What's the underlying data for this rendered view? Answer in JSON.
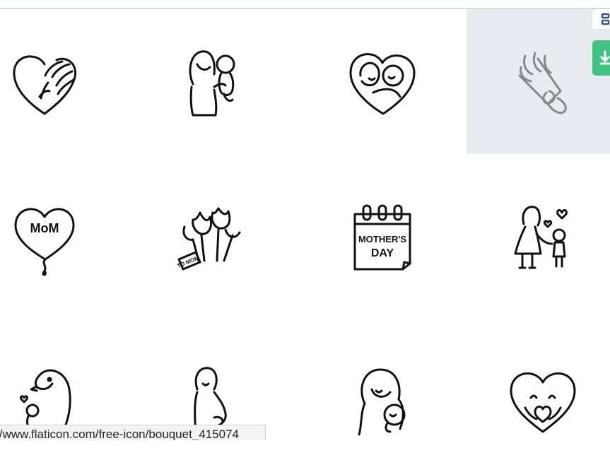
{
  "icons": [
    {
      "name": "heart-hand-icon"
    },
    {
      "name": "mother-holding-child-icon"
    },
    {
      "name": "mother-baby-heart-icon"
    },
    {
      "name": "bouquet-icon",
      "hovered": true
    },
    {
      "name": "mom-heart-balloon-icon",
      "text": "MoM"
    },
    {
      "name": "tulips-tag-icon",
      "text": "TO MOM"
    },
    {
      "name": "mothers-day-calendar-icon",
      "text_line1": "MOTHER'S",
      "text_line2": "DAY"
    },
    {
      "name": "mother-daughter-walking-icon"
    },
    {
      "name": "penguin-mother-chick-icon"
    },
    {
      "name": "pregnant-mother-icon"
    },
    {
      "name": "mother-long-hair-baby-icon"
    },
    {
      "name": "heart-hug-icon"
    }
  ],
  "status_bar": {
    "url": "//www.flaticon.com/free-icon/bouquet_415074"
  },
  "colors": {
    "hover_bg": "#e8ecf0",
    "accent_green": "#41c383",
    "stroke": "#111111"
  }
}
